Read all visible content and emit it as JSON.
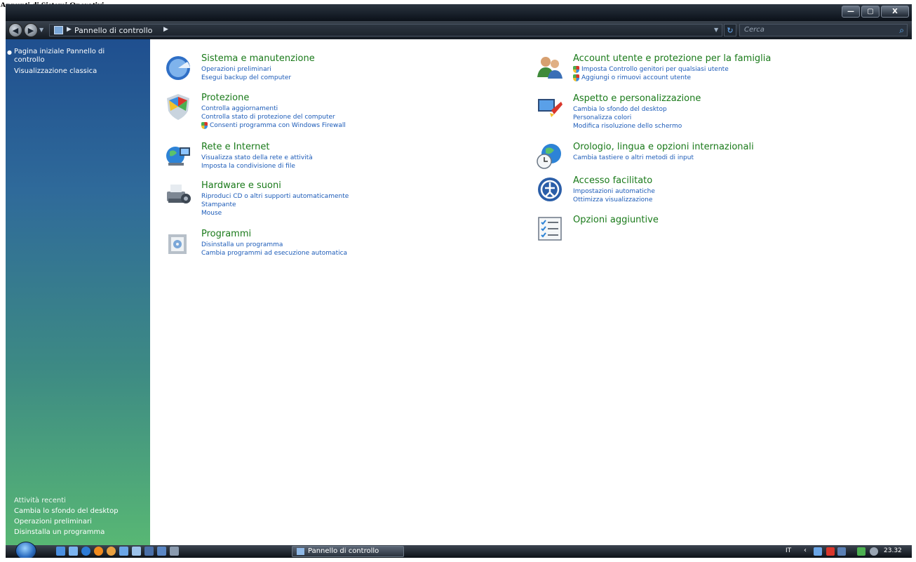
{
  "page_caption": "Appunti di Sistemi Operativi",
  "window": {
    "controls": [
      "—",
      "▢",
      "X"
    ]
  },
  "address": {
    "crumbs": [
      "Pannello di controllo"
    ],
    "search_placeholder": "Cerca"
  },
  "sidebar": {
    "top_links": [
      "Pagina iniziale Pannello di controllo",
      "Visualizzazione classica"
    ],
    "recent_heading": "Attività recenti",
    "recent_links": [
      "Cambia lo sfondo del desktop",
      "Operazioni preliminari",
      "Disinstalla un programma"
    ]
  },
  "categories": [
    {
      "title": "Sistema e manutenzione",
      "icon": "system-icon",
      "links": [
        {
          "label": "Operazioni preliminari",
          "shield": false
        },
        {
          "label": "Esegui backup del computer",
          "shield": false
        }
      ]
    },
    {
      "title": "Protezione",
      "icon": "security-shield-icon",
      "links": [
        {
          "label": "Controlla aggiornamenti",
          "shield": false
        },
        {
          "label": "Controlla stato di protezione del computer",
          "shield": false
        },
        {
          "label": "Consenti programma con Windows Firewall",
          "shield": true
        }
      ]
    },
    {
      "title": "Rete e Internet",
      "icon": "network-globe-icon",
      "links": [
        {
          "label": "Visualizza stato della rete e attività",
          "shield": false
        },
        {
          "label": "Imposta la condivisione di file",
          "shield": false
        }
      ]
    },
    {
      "title": "Hardware e suoni",
      "icon": "printer-speaker-icon",
      "links": [
        {
          "label": "Riproduci CD o altri supporti automaticamente",
          "shield": false
        },
        {
          "label": "Stampante",
          "shield": false
        },
        {
          "label": "Mouse",
          "shield": false
        }
      ]
    },
    {
      "title": "Programmi",
      "icon": "programs-box-icon",
      "links": [
        {
          "label": "Disinstalla un programma",
          "shield": false
        },
        {
          "label": "Cambia programmi ad esecuzione automatica",
          "shield": false
        }
      ]
    },
    {
      "title": "Account utente e protezione per la famiglia",
      "icon": "users-icon",
      "links": [
        {
          "label": "Imposta Controllo genitori per qualsiasi utente",
          "shield": true
        },
        {
          "label": "Aggiungi o rimuovi account utente",
          "shield": true
        }
      ]
    },
    {
      "title": "Aspetto e personalizzazione",
      "icon": "appearance-icon",
      "links": [
        {
          "label": "Cambia lo sfondo del desktop",
          "shield": false
        },
        {
          "label": "Personalizza colori",
          "shield": false
        },
        {
          "label": "Modifica risoluzione dello schermo",
          "shield": false
        }
      ]
    },
    {
      "title": "Orologio, lingua e opzioni internazionali",
      "icon": "clock-globe-icon",
      "links": [
        {
          "label": "Cambia tastiere o altri metodi di input",
          "shield": false
        }
      ]
    },
    {
      "title": "Accesso facilitato",
      "icon": "ease-of-access-icon",
      "links": [
        {
          "label": "Impostazioni automatiche",
          "shield": false
        },
        {
          "label": "Ottimizza visualizzazione",
          "shield": false
        }
      ]
    },
    {
      "title": "Opzioni aggiuntive",
      "icon": "checklist-icon",
      "links": []
    }
  ],
  "taskbar": {
    "task_label": "Pannello di controllo",
    "lang": "IT",
    "clock": "23.32"
  }
}
